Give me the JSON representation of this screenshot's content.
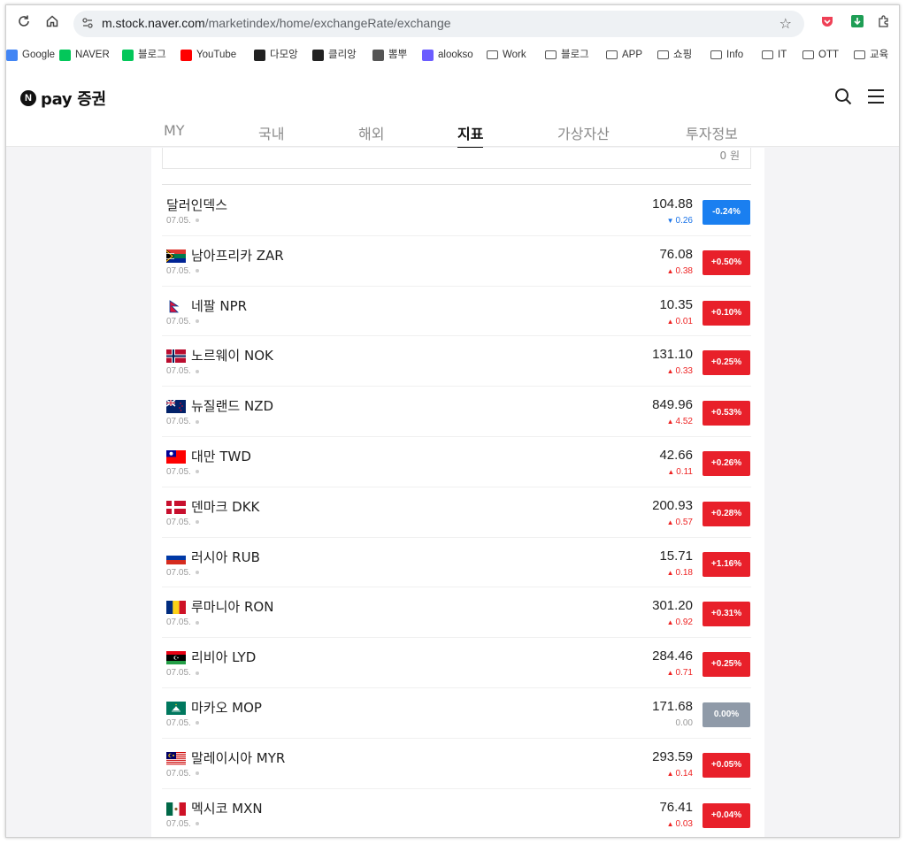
{
  "browser": {
    "url_host": "m.stock.naver.com",
    "url_path": "/marketindex/home/exchangeRate/exchange"
  },
  "bookmarks": [
    {
      "label": "Google",
      "icon": "google-icon",
      "color": "#4285f4"
    },
    {
      "label": "NAVER",
      "icon": "naver-icon",
      "color": "#03c75a"
    },
    {
      "label": "블로그",
      "icon": "blog-icon",
      "color": "#03c75a"
    },
    {
      "label": "YouTube",
      "icon": "youtube-icon",
      "color": "#ff0000"
    },
    {
      "label": "다모앙",
      "icon": "damoang-icon",
      "color": "#222222"
    },
    {
      "label": "클리앙",
      "icon": "clien-icon",
      "color": "#222222"
    },
    {
      "label": "뽐뿌",
      "icon": "ppomppu-icon",
      "color": "#555555"
    },
    {
      "label": "alookso",
      "icon": "alookso-icon",
      "color": "#6b5cff"
    },
    {
      "label": "Work",
      "icon": "folder-icon"
    },
    {
      "label": "블로그",
      "icon": "folder-icon"
    },
    {
      "label": "APP",
      "icon": "folder-icon"
    },
    {
      "label": "쇼핑",
      "icon": "folder-icon"
    },
    {
      "label": "Info",
      "icon": "folder-icon"
    },
    {
      "label": "IT",
      "icon": "folder-icon"
    },
    {
      "label": "OTT",
      "icon": "folder-icon"
    },
    {
      "label": "교육",
      "icon": "folder-icon"
    }
  ],
  "header": {
    "logo_mark": "N",
    "logo_text": "pay 증권"
  },
  "tabs": [
    {
      "label": "MY",
      "active": false
    },
    {
      "label": "국내",
      "active": false
    },
    {
      "label": "해외",
      "active": false
    },
    {
      "label": "지표",
      "active": true
    },
    {
      "label": "가상자산",
      "active": false
    },
    {
      "label": "투자정보",
      "active": false
    }
  ],
  "top_box_value": "0 원",
  "colors": {
    "up": "#e8202a",
    "down": "#1a7ff0",
    "flat": "#8f9aa8"
  },
  "rows": [
    {
      "name": "달러인덱스",
      "flag": "",
      "date": "07.05.",
      "price": "104.88",
      "change": "0.26",
      "direction": "down",
      "pct": "-0.24%"
    },
    {
      "name": "남아프리카 ZAR",
      "flag": "za",
      "date": "07.05.",
      "price": "76.08",
      "change": "0.38",
      "direction": "up",
      "pct": "+0.50%"
    },
    {
      "name": "네팔 NPR",
      "flag": "np",
      "date": "07.05.",
      "price": "10.35",
      "change": "0.01",
      "direction": "up",
      "pct": "+0.10%"
    },
    {
      "name": "노르웨이 NOK",
      "flag": "no",
      "date": "07.05.",
      "price": "131.10",
      "change": "0.33",
      "direction": "up",
      "pct": "+0.25%"
    },
    {
      "name": "뉴질랜드 NZD",
      "flag": "nz",
      "date": "07.05.",
      "price": "849.96",
      "change": "4.52",
      "direction": "up",
      "pct": "+0.53%"
    },
    {
      "name": "대만 TWD",
      "flag": "tw",
      "date": "07.05.",
      "price": "42.66",
      "change": "0.11",
      "direction": "up",
      "pct": "+0.26%"
    },
    {
      "name": "덴마크 DKK",
      "flag": "dk",
      "date": "07.05.",
      "price": "200.93",
      "change": "0.57",
      "direction": "up",
      "pct": "+0.28%"
    },
    {
      "name": "러시아 RUB",
      "flag": "ru",
      "date": "07.05.",
      "price": "15.71",
      "change": "0.18",
      "direction": "up",
      "pct": "+1.16%"
    },
    {
      "name": "루마니아 RON",
      "flag": "ro",
      "date": "07.05.",
      "price": "301.20",
      "change": "0.92",
      "direction": "up",
      "pct": "+0.31%"
    },
    {
      "name": "리비아 LYD",
      "flag": "ly",
      "date": "07.05.",
      "price": "284.46",
      "change": "0.71",
      "direction": "up",
      "pct": "+0.25%"
    },
    {
      "name": "마카오 MOP",
      "flag": "mo",
      "date": "07.05.",
      "price": "171.68",
      "change": "0.00",
      "direction": "flat",
      "pct": "0.00%"
    },
    {
      "name": "말레이시아 MYR",
      "flag": "my",
      "date": "07.05.",
      "price": "293.59",
      "change": "0.14",
      "direction": "up",
      "pct": "+0.05%"
    },
    {
      "name": "멕시코 MXN",
      "flag": "mx",
      "date": "07.05.",
      "price": "76.41",
      "change": "0.03",
      "direction": "up",
      "pct": "+0.04%"
    }
  ]
}
